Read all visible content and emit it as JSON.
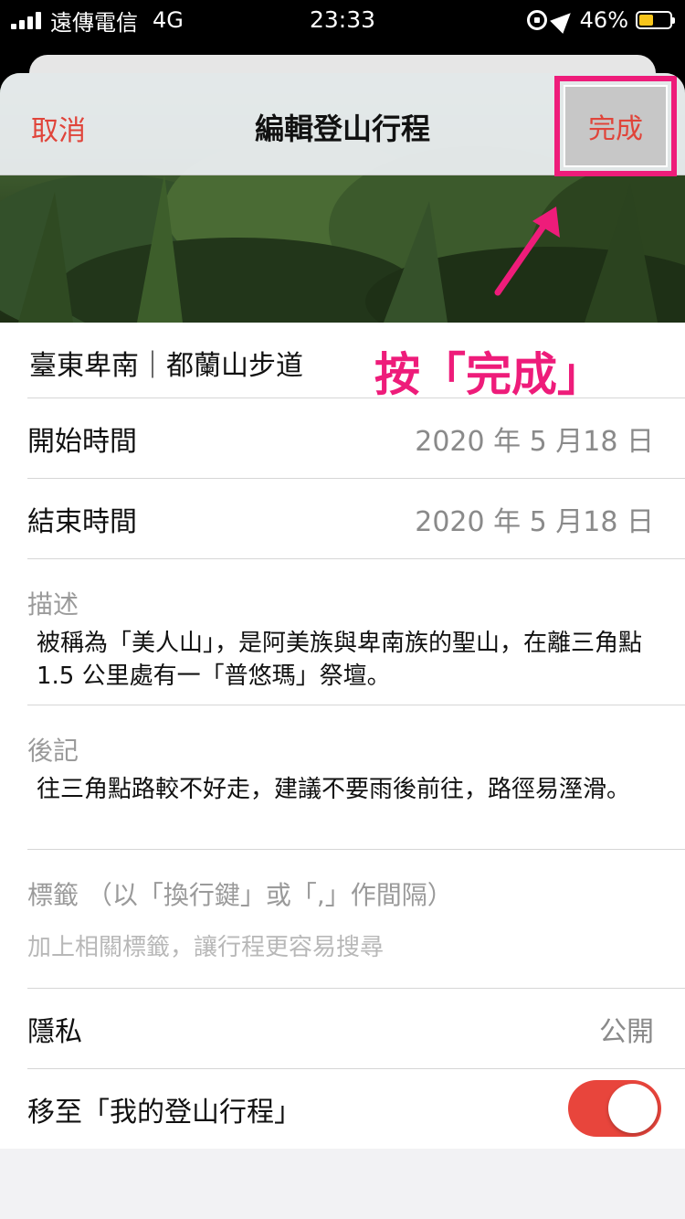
{
  "status_bar": {
    "carrier": "遠傳電信",
    "network": "4G",
    "time": "23:33",
    "battery": "46%",
    "battery_level": 0.46
  },
  "nav": {
    "cancel": "取消",
    "title": "編輯登山行程",
    "done": "完成"
  },
  "annotation": "按「完成」",
  "form": {
    "trip_title": "臺東卑南｜都蘭山步道",
    "start_label": "開始時間",
    "start_value": "2020 年 5 月18 日",
    "end_label": "結束時間",
    "end_value": "2020 年 5 月18 日",
    "description_label": "描述",
    "description": "被稱為「美人山」，是阿美族與卑南族的聖山，在離三角點1.5 公里處有一「普悠瑪」祭壇。",
    "notes_label": "後記",
    "notes": "往三角點路較不好走，建議不要雨後前往，路徑易溼滑。",
    "tags_label": "標籤 （以「換行鍵」或「,」作間隔）",
    "tags_placeholder": "加上相關標籤，讓行程更容易搜尋",
    "privacy_label": "隱私",
    "privacy_value": "公開",
    "move_label": "移至「我的登山行程」",
    "move_enabled": true
  },
  "colors": {
    "accent": "#e0443a",
    "highlight": "#ee1c7a",
    "toggle_on": "#e8453c"
  }
}
